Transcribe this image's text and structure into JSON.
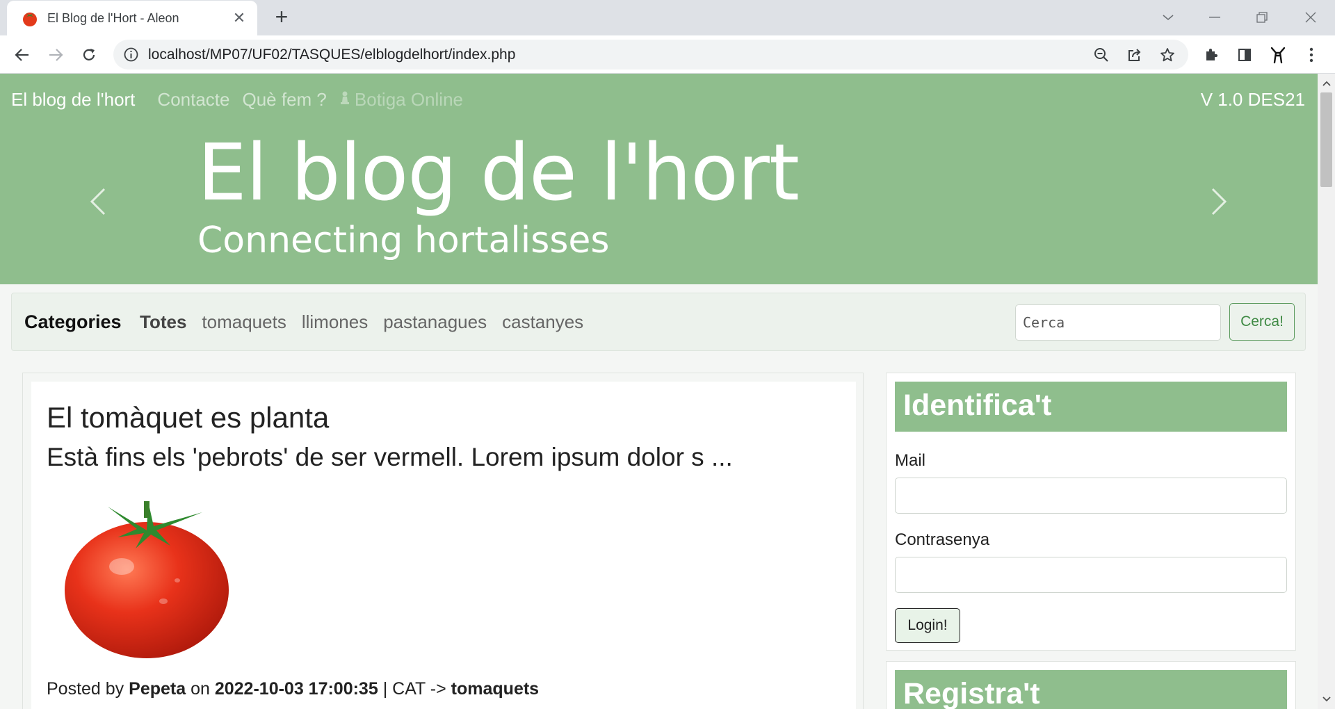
{
  "browser": {
    "tab_title": "El Blog de l'Hort - Aleon",
    "url": "localhost/MP07/UF02/TASQUES/elblogdelhort/index.php"
  },
  "navbar": {
    "brand": "El blog de l'hort",
    "links": [
      "Contacte",
      "Què fem ?"
    ],
    "disabled_link": "Botiga Online",
    "version": "V 1.0 DES21"
  },
  "hero": {
    "title": "El blog de l'hort",
    "subtitle": "Connecting hortalisses"
  },
  "categories": {
    "heading": "Categories",
    "items": [
      "Totes",
      "tomaquets",
      "llimones",
      "pastanagues",
      "castanyes"
    ],
    "active": "Totes",
    "search_placeholder": "Cerca",
    "search_button": "Cerca!"
  },
  "post": {
    "title": "El tomàquet es planta",
    "excerpt": "Està fins els 'pebrots' de ser vermell. Lorem ipsum dolor s ...",
    "posted_by_label": "Posted by",
    "author": "Pepeta",
    "on_label": "on",
    "date": "2022-10-03 17:00:35",
    "cat_label": "| CAT ->",
    "category": "tomaquets"
  },
  "login": {
    "title": "Identifica't",
    "mail_label": "Mail",
    "password_label": "Contrasenya",
    "button": "Login!"
  },
  "register": {
    "title": "Registra't"
  },
  "colors": {
    "brand_green": "#8fbe8d",
    "button_green": "#3f8a44",
    "tomato_red": "#e33a1b"
  }
}
